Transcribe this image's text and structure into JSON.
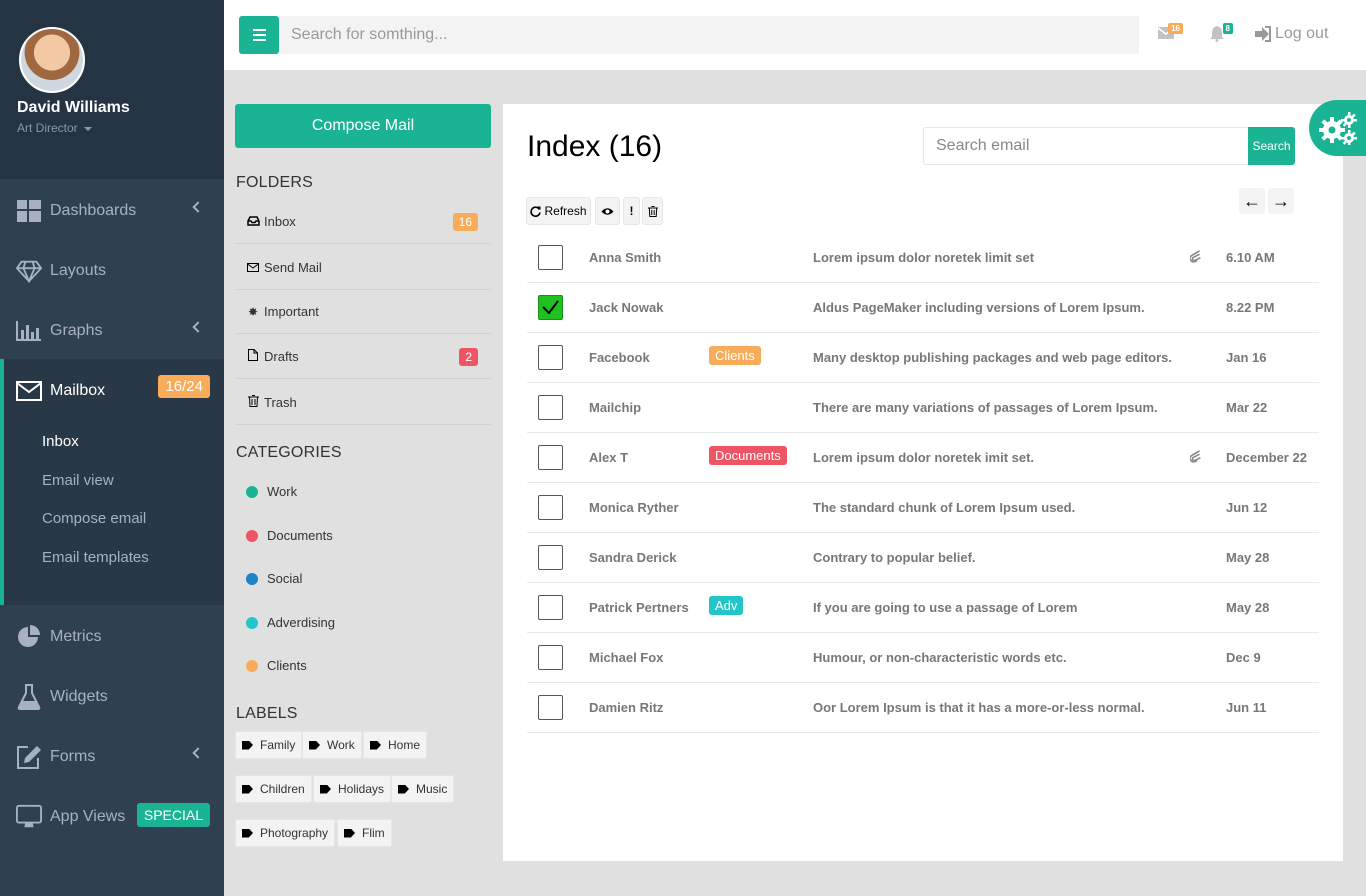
{
  "profile": {
    "name": "David Williams",
    "role": "Art Director"
  },
  "nav": {
    "dashboards": "Dashboards",
    "layouts": "Layouts",
    "graphs": "Graphs",
    "mailbox": "Mailbox",
    "mailbox_badge": "16/24",
    "mailbox_sub": [
      "Inbox",
      "Email view",
      "Compose email",
      "Email templates"
    ],
    "metrics": "Metrics",
    "widgets": "Widgets",
    "forms": "Forms",
    "app_views": "App Views",
    "app_views_badge": "SPECIAL"
  },
  "topbar": {
    "search_placeholder": "Search for somthing...",
    "messages_count": "16",
    "alerts_count": "8",
    "logout": "Log out"
  },
  "compose_label": "Compose Mail",
  "folders_title": "FOLDERS",
  "folders": [
    {
      "label": "Inbox",
      "count": "16"
    },
    {
      "label": "Send Mail"
    },
    {
      "label": "Important"
    },
    {
      "label": "Drafts",
      "count": "2"
    },
    {
      "label": "Trash"
    }
  ],
  "categories_title": "CATEGORIES",
  "categories": [
    {
      "label": "Work",
      "color": "#1ab394"
    },
    {
      "label": "Documents",
      "color": "#ed5565"
    },
    {
      "label": "Social",
      "color": "#1c84c6"
    },
    {
      "label": "Adverdising",
      "color": "#23c6c8"
    },
    {
      "label": "Clients",
      "color": "#f8ac59"
    }
  ],
  "labels_title": "LABELS",
  "labels": [
    "Family",
    "Work",
    "Home",
    "Children",
    "Holidays",
    "Music",
    "Photography",
    "Flim"
  ],
  "main": {
    "title": "Index (16)",
    "search_placeholder": "Search email",
    "search_button": "Search",
    "refresh": "Refresh"
  },
  "emails": [
    {
      "from": "Anna Smith",
      "subject": "Lorem ipsum dolor noretek limit set",
      "time": "6.10 AM",
      "attachment": true,
      "checked": false
    },
    {
      "from": "Jack Nowak",
      "subject": "Aldus PageMaker including versions of Lorem Ipsum.",
      "time": "8.22 PM",
      "checked": true
    },
    {
      "from": "Facebook",
      "label": "Clients",
      "label_color": "#f8ac59",
      "subject": "Many desktop publishing packages and web page editors.",
      "time": "Jan 16"
    },
    {
      "from": "Mailchip",
      "subject": "There are many variations of passages of Lorem Ipsum.",
      "time": "Mar 22"
    },
    {
      "from": "Alex T",
      "label": "Documents",
      "label_color": "#ed5565",
      "subject": "Lorem ipsum dolor noretek imit set.",
      "time": "December 22",
      "attachment": true
    },
    {
      "from": "Monica Ryther",
      "subject": "The standard chunk of Lorem Ipsum used.",
      "time": "Jun 12"
    },
    {
      "from": "Sandra Derick",
      "subject": "Contrary to popular belief.",
      "time": "May 28"
    },
    {
      "from": "Patrick Pertners",
      "label": "Adv",
      "label_color": "#23c6c8",
      "subject": "If you are going to use a passage of Lorem",
      "time": "May 28"
    },
    {
      "from": "Michael Fox",
      "subject": "Humour, or non-characteristic words etc.",
      "time": "Dec 9"
    },
    {
      "from": "Damien Ritz",
      "subject": "Oor Lorem Ipsum is that it has a more-or-less normal.",
      "time": "Jun 11"
    }
  ],
  "colors": {
    "accent": "#1ab394",
    "sidebar": "#2f4050",
    "warning": "#f8ac59",
    "danger": "#ed5565"
  }
}
